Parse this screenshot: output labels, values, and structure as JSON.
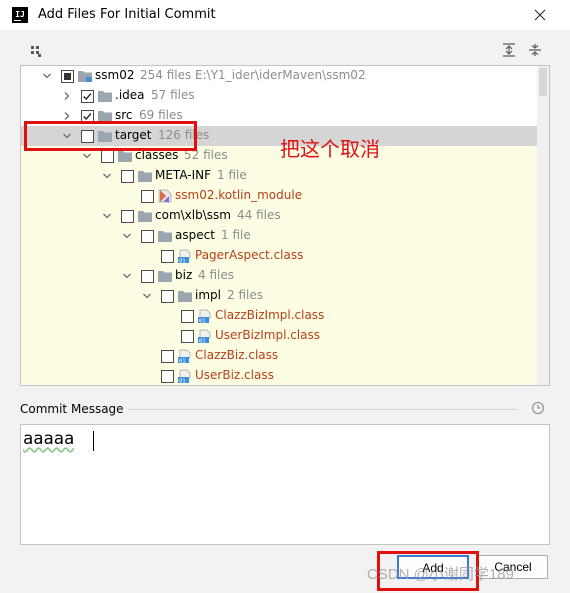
{
  "window": {
    "title": "Add Files For Initial Commit",
    "app_icon_text": "IJ"
  },
  "toolbar": {
    "group_icon": "group-by-icon",
    "expand_icon": "expand-all-icon",
    "collapse_icon": "collapse-all-icon"
  },
  "tree": [
    {
      "name": "ssm02",
      "meta": "254 files  E:\\Y1_ider\\iderMaven\\ssm02",
      "state": "partial",
      "arrow": "down",
      "icon": "module",
      "level": 0
    },
    {
      "name": ".idea",
      "meta": "57 files",
      "state": "checked",
      "arrow": "right",
      "icon": "folder",
      "level": 1
    },
    {
      "name": "src",
      "meta": "69 files",
      "state": "checked",
      "arrow": "right",
      "icon": "folder",
      "level": 1
    },
    {
      "name": "target",
      "meta": "126 files",
      "state": "unchecked",
      "arrow": "down",
      "icon": "folder",
      "level": 1
    },
    {
      "name": "classes",
      "meta": "52 files",
      "state": "unchecked",
      "arrow": "down",
      "icon": "folder",
      "level": 2
    },
    {
      "name": "META-INF",
      "meta": "1 file",
      "state": "unchecked",
      "arrow": "down",
      "icon": "folder",
      "level": 3
    },
    {
      "name": "ssm02.kotlin_module",
      "meta": "",
      "state": "unchecked",
      "arrow": "none",
      "icon": "kotlin",
      "level": 4,
      "file": true
    },
    {
      "name": "com\\xlb\\ssm",
      "meta": "44 files",
      "state": "unchecked",
      "arrow": "down",
      "icon": "folder",
      "level": 3
    },
    {
      "name": "aspect",
      "meta": "1 file",
      "state": "unchecked",
      "arrow": "down",
      "icon": "folder",
      "level": 4
    },
    {
      "name": "PagerAspect.class",
      "meta": "",
      "state": "unchecked",
      "arrow": "none",
      "icon": "class",
      "level": 5,
      "file": true
    },
    {
      "name": "biz",
      "meta": "4 files",
      "state": "unchecked",
      "arrow": "down",
      "icon": "folder",
      "level": 4
    },
    {
      "name": "impl",
      "meta": "2 files",
      "state": "unchecked",
      "arrow": "down",
      "icon": "folder",
      "level": 5
    },
    {
      "name": "ClazzBizImpl.class",
      "meta": "",
      "state": "unchecked",
      "arrow": "none",
      "icon": "class",
      "level": 6,
      "file": true
    },
    {
      "name": "UserBizImpl.class",
      "meta": "",
      "state": "unchecked",
      "arrow": "none",
      "icon": "class",
      "level": 6,
      "file": true
    },
    {
      "name": "ClazzBiz.class",
      "meta": "",
      "state": "unchecked",
      "arrow": "none",
      "icon": "class",
      "level": 5,
      "file": true
    },
    {
      "name": "UserBiz.class",
      "meta": "",
      "state": "unchecked",
      "arrow": "none",
      "icon": "class",
      "level": 5,
      "file": true
    }
  ],
  "annotation": "把这个取消",
  "commit": {
    "label": "Commit Message",
    "value": "aaaaa",
    "history_icon": "history-clock-icon"
  },
  "buttons": {
    "add": "Add",
    "cancel": "Cancel"
  },
  "watermark": "CSDN @小谢同学189",
  "colors": {
    "highlight_red": "#e01010",
    "unversioned_file": "#b3401b",
    "ignored_background": "#fdfde4",
    "selection": "#d5d5d5",
    "default_button_border": "#3c78d8"
  }
}
